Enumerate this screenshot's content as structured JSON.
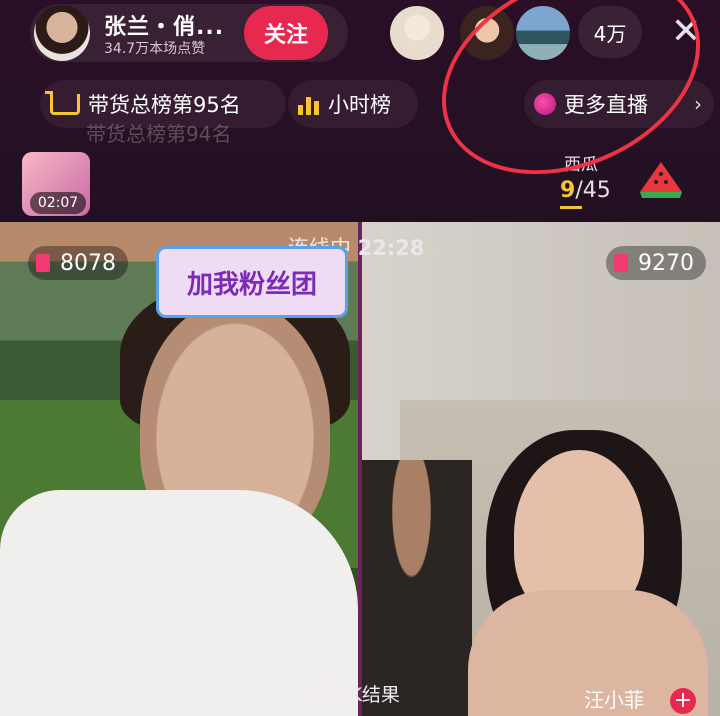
{
  "host": {
    "name": "张兰・俏...",
    "likes": "34.7万本场点赞",
    "follow_label": "关注"
  },
  "viewers": {
    "count": "4万"
  },
  "close_label": "✕",
  "rank_bar": {
    "sales_rank": "带货总榜第95名",
    "sales_rank_ghost": "带货总榜第94名",
    "hourly_rank": "小时榜",
    "more_label": "更多直播",
    "chevron": "›"
  },
  "gift": {
    "timer": "02:07"
  },
  "watermelon": {
    "label": "西瓜",
    "current": "9",
    "total": "/45"
  },
  "pk": {
    "status": "连线中",
    "time": "22:28",
    "result_label": "上场PK结果"
  },
  "scores": {
    "left": "8078",
    "right": "9270"
  },
  "fan_sticker": "加我粉丝团",
  "guest": {
    "name": "汪小菲",
    "plus": "+"
  },
  "colors": {
    "accent_red": "#e8294f",
    "gold": "#f6c435",
    "annotation": "#ee3346"
  }
}
